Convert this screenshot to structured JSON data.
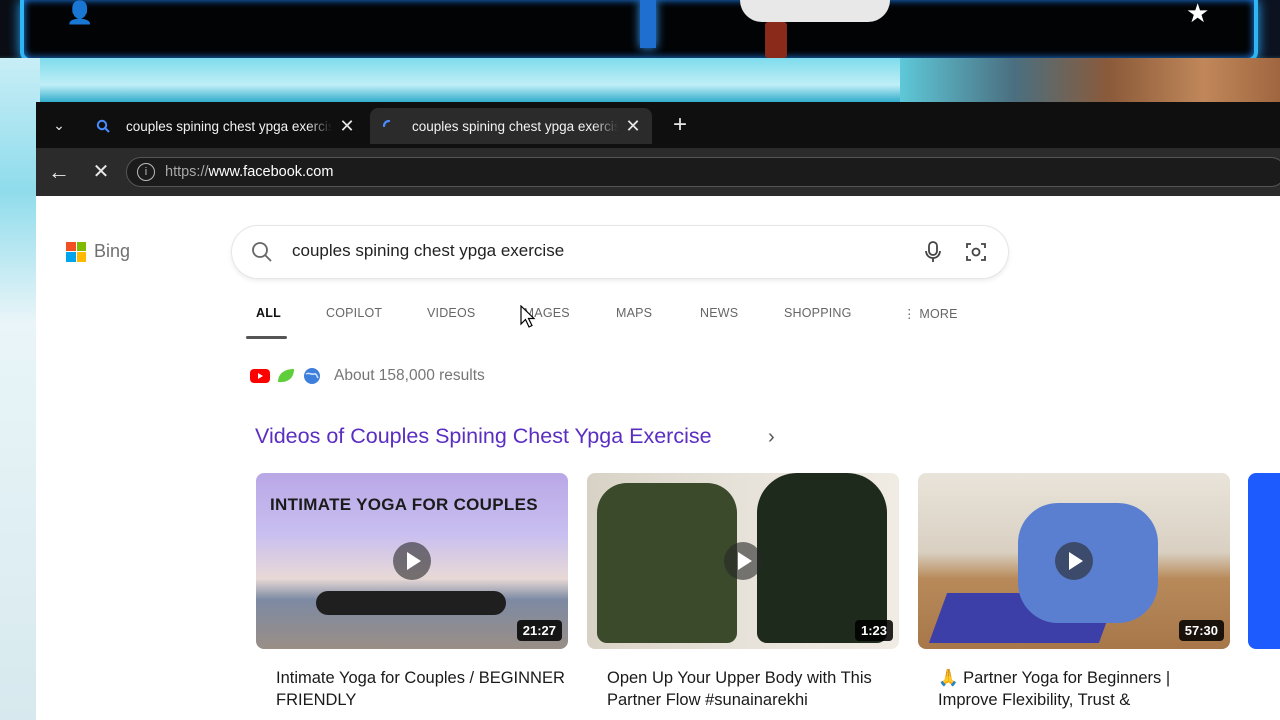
{
  "tabs": [
    {
      "title": "couples spining chest ypga exercis",
      "state": "inactive"
    },
    {
      "title": "couples spining chest ypga exercis",
      "state": "loading"
    }
  ],
  "address_bar": {
    "url_protocol": "https://",
    "url_host": "www.facebook.com"
  },
  "bing": {
    "logo_text": "Bing",
    "search_query": "couples spining chest ypga exercise"
  },
  "scopes": [
    "ALL",
    "COPILOT",
    "VIDEOS",
    "IMAGES",
    "MAPS",
    "NEWS",
    "SHOPPING",
    "MORE"
  ],
  "active_scope": "ALL",
  "results": {
    "count_text": "About 158,000 results"
  },
  "videos": {
    "heading": "Videos of Couples Spining Chest Ypga Exercise",
    "items": [
      {
        "overlay_text": "INTIMATE YOGA FOR COUPLES",
        "duration": "21:27",
        "title": "Intimate Yoga for Couples / BEGINNER FRIENDLY"
      },
      {
        "duration": "1:23",
        "title": "Open Up Your Upper Body with This Partner Flow #sunainarekhi"
      },
      {
        "duration": "57:30",
        "title": "🙏 Partner Yoga for Beginners | Improve Flexibility, Trust &"
      }
    ]
  },
  "colors": {
    "link_purple": "#5b2ec2",
    "tab_bar": "#0f0f10",
    "toolbar": "#2b2b2c"
  }
}
